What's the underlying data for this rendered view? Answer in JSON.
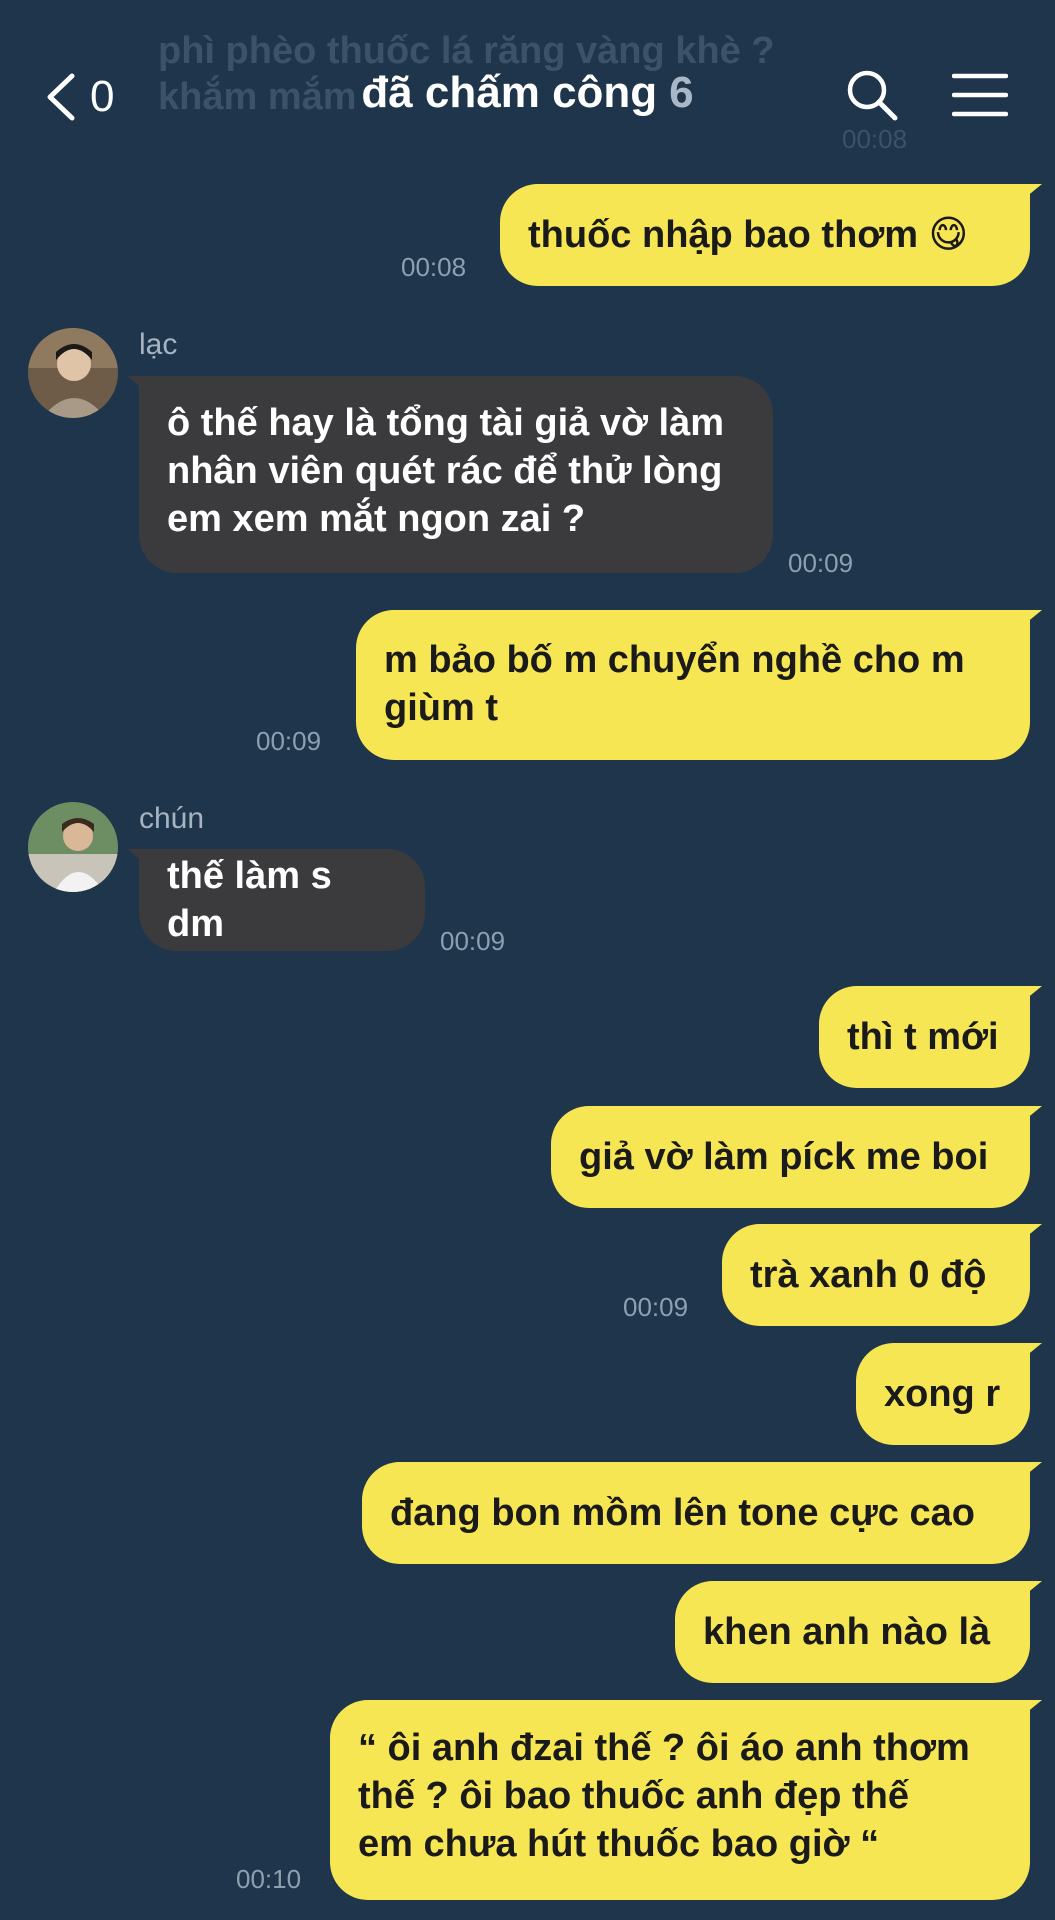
{
  "ghost": {
    "line1": "phì phèo thuốc lá răng vàng khè ?",
    "line2": "khắm mắm",
    "time": "00:08"
  },
  "header": {
    "back_count": "0",
    "title": "đã chấm công",
    "member_count": "6",
    "icons": [
      "back-chevron-icon",
      "search-icon",
      "menu-icon"
    ]
  },
  "messages": [
    {
      "text": "thuốc nhập bao thơm 😋",
      "time": "00:08"
    },
    {
      "sender": "lạc",
      "text_lines": [
        "ô thế hay là tổng tài giả vờ làm",
        "nhân viên quét rác để thử lòng",
        "em xem mắt ngon zai ?"
      ],
      "time": "00:09"
    },
    {
      "text_lines": [
        "m bảo bố m chuyển nghề cho m",
        "giùm t"
      ],
      "time": "00:09"
    },
    {
      "sender": "chún",
      "text": "thế làm s dm",
      "time": "00:09"
    },
    {
      "text": "thì t mới"
    },
    {
      "text": "giả vờ làm píck me boi"
    },
    {
      "text": "trà xanh 0 độ",
      "time": "00:09"
    },
    {
      "text": "xong r"
    },
    {
      "text": "đang bon mồm lên tone cực cao"
    },
    {
      "text": "khen anh nào là"
    },
    {
      "text_lines": [
        "“ ôi anh đzai thế ? ôi áo anh thơm",
        "thế ? ôi bao thuốc anh đẹp thế",
        "em chưa hút thuốc bao giờ “"
      ],
      "time": "00:10"
    }
  ],
  "colors": {
    "background": "#1e354b",
    "my_bubble": "#f7e653",
    "their_bubble": "#3b3b3d"
  }
}
